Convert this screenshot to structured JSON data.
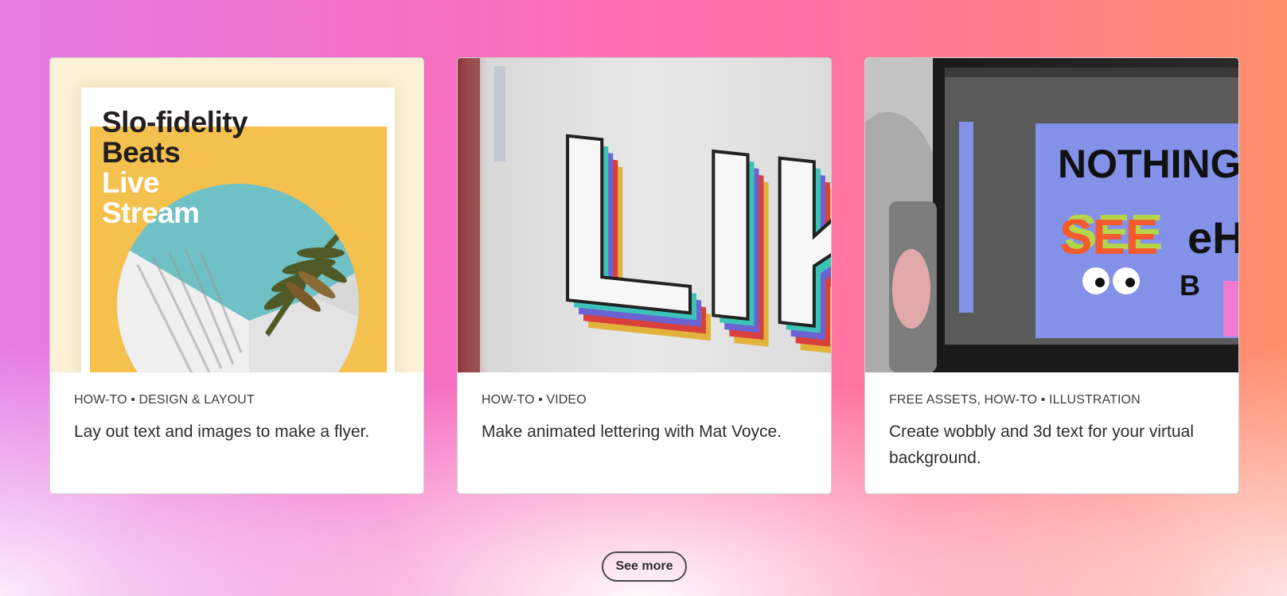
{
  "cards": [
    {
      "meta": "HOW-TO • DESIGN & LAYOUT",
      "title": "Lay out text and images to make a flyer.",
      "image": {
        "line1": "Slo-fidelity",
        "line2": "Beats",
        "line3": "Live",
        "line4": "Stream"
      }
    },
    {
      "meta": "HOW-TO • VIDEO",
      "title": "Make animated lettering with Mat Voyce.",
      "image": {
        "word": "LIKE"
      }
    },
    {
      "meta": "FREE ASSETS, HOW-TO • ILLUSTRATION",
      "title": "Create wobbly and 3d text for your virtual background.",
      "image": {
        "line1": "NOTHING",
        "line2": "SEE",
        "line3": "eH",
        "line4": "B"
      }
    }
  ],
  "see_more_label": "See more",
  "colors": {
    "flyer_yellow": "#f4c04e",
    "flyer_teal": "#6fc1c6",
    "screen_blue": "#8391e8",
    "see_orange": "#f45a2e",
    "see_green": "#b6d64a"
  }
}
